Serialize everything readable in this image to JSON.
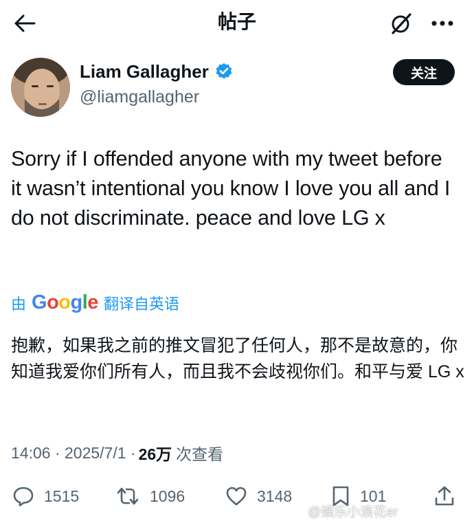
{
  "header": {
    "title": "帖子"
  },
  "author": {
    "display_name": "Liam Gallagher",
    "handle": "@liamgallagher",
    "verified": true,
    "follow_label": "关注"
  },
  "tweet": {
    "text": "Sorry if I offended anyone with my tweet before it wasn’t intentional you know I love you all and I do not discriminate. peace and love LG x",
    "translated_prefix": "由",
    "translated_brand": "Google",
    "translated_suffix": "翻译自英语",
    "translation": "抱歉，如果我之前的推文冒犯了任何人，那不是故意的，你知道我爱你们所有人，而且我不会歧视你们。和平与爱 LG x"
  },
  "meta": {
    "time": "14:06 · 2025/7/1 · ",
    "views": "26万",
    "views_label": "次查看"
  },
  "actions": {
    "replies": "1515",
    "reposts": "1096",
    "likes": "3148",
    "bookmarks": "101"
  },
  "watermark": "@娱乐小浪花er",
  "colors": {
    "accent": "#1d9bf0",
    "text": "#0f1419",
    "muted": "#536471"
  }
}
